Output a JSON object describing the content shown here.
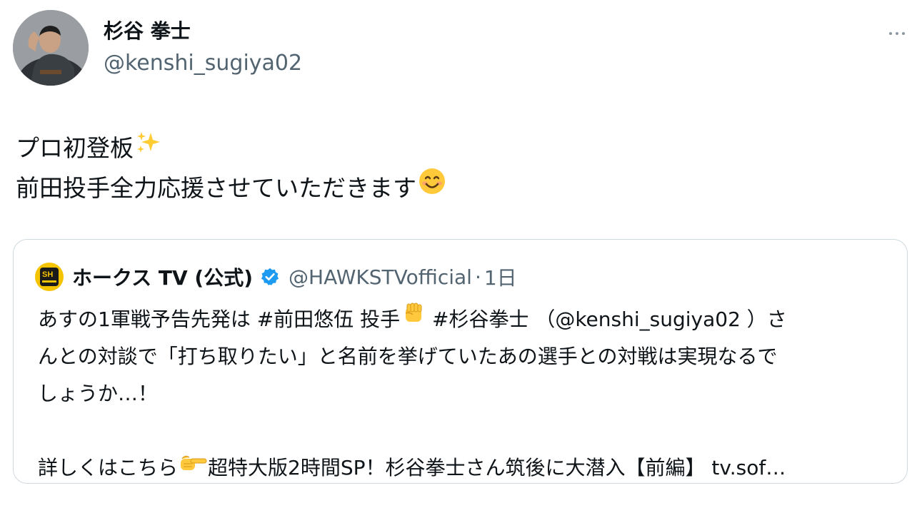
{
  "author": {
    "display_name": "杉谷 拳士",
    "handle": "@kenshi_sugiya02"
  },
  "tweet": {
    "line1": "プロ初登板",
    "line1_emoji": "sparkles-emoji",
    "line2": "前田投手全力応援させていただきます",
    "line2_emoji": "smiling-face-emoji"
  },
  "quoted_tweet": {
    "display_name": "ホークス TV (公式)",
    "verified": true,
    "handle": "@HAWKSTVofficial",
    "separator": "·",
    "time": "1日",
    "line1_a": "あすの1軍戦予告先発は #前田悠伍 投手",
    "line1_emoji": "raised-fist-emoji",
    "line1_b": " #杉谷拳士 （@kenshi_sugiya02 ）さ",
    "line2": "んとの対談で「打ち取りたい」と名前を挙げていたあの選手との対戦は実現なるで",
    "line3": "しょうか…！",
    "line5_a": "詳しくはこちら",
    "line5_emoji": "pointing-right-emoji",
    "line5_b": "超特大版2時間SP！杉谷拳士さん筑後に大潜入【前編】 tv.sof…"
  },
  "colors": {
    "text_primary": "#0f1419",
    "text_secondary": "#536471",
    "border": "#cfd9de",
    "verified_blue": "#1d9bf0",
    "hawks_yellow": "#f5c400"
  },
  "icons": {
    "more": "more-horizontal-icon",
    "verified": "verified-badge-icon"
  }
}
